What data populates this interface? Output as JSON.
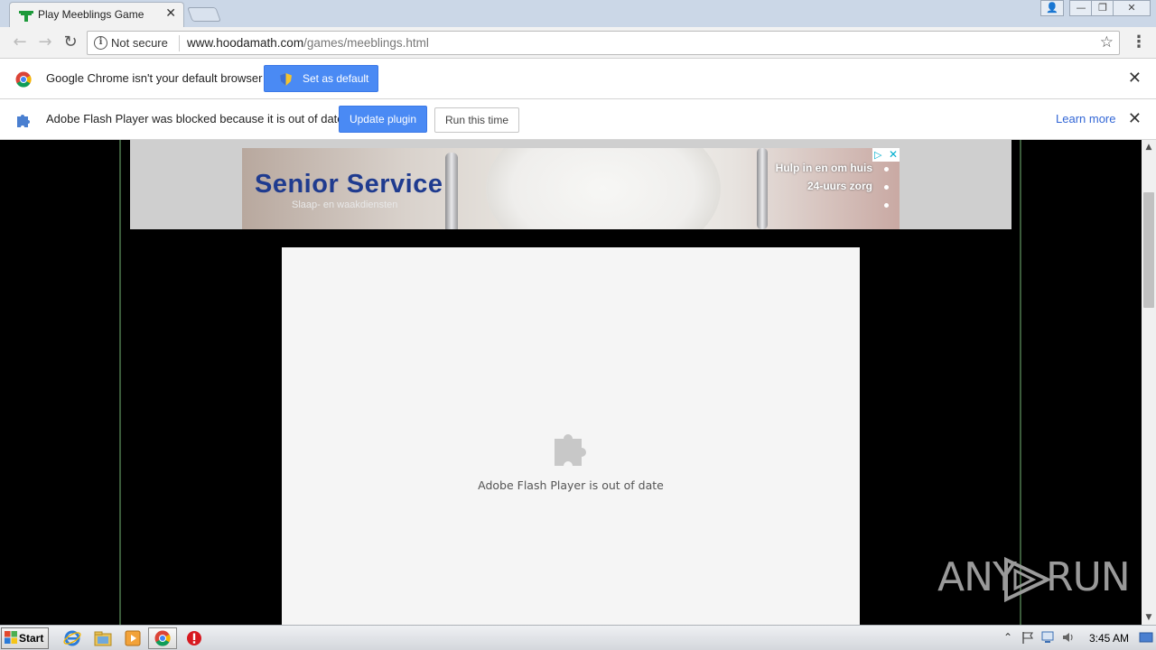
{
  "browser": {
    "tab": {
      "title": "Play Meeblings Game",
      "close": "✕"
    },
    "window_buttons": {
      "user": "👤",
      "minimize": "—",
      "restore": "❐",
      "close": "✕"
    },
    "address": {
      "security_label": "Not secure",
      "url_host": "www.hoodamath.com",
      "url_path": "/games/meeblings.html"
    },
    "nav_glyphs": {
      "back": "←",
      "forward": "→",
      "reload": "↻",
      "star": "☆",
      "menu": "⋮"
    }
  },
  "infobars": {
    "default_browser": {
      "message": "Google Chrome isn't your default browser",
      "button": "Set as default",
      "close": "✕"
    },
    "flash": {
      "message": "Adobe Flash Player was blocked because it is out of date",
      "update_button": "Update plugin",
      "run_button": "Run this time",
      "learn_more": "Learn more",
      "close": "✕"
    }
  },
  "ad": {
    "title": "Senior Service",
    "subtitle": "Slaap- en waakdiensten",
    "bullets": [
      "Hulp in en om huis",
      "24-uurs zorg",
      ""
    ],
    "choices_play": "▷",
    "choices_close": "✕"
  },
  "plugin_placeholder": {
    "message": "Adobe Flash Player is out of date",
    "icon": "puzzle-piece-icon"
  },
  "watermark": {
    "left": "ANY",
    "right": "RUN"
  },
  "scrollbar": {
    "up": "▲",
    "down": "▼"
  },
  "taskbar": {
    "start_label": "Start",
    "clock": "3:45 AM",
    "tray_expand": "⌃"
  },
  "colors": {
    "page_background": "#000000",
    "infobar_button": "#4a8af4",
    "link": "#3367d6",
    "placeholder_bg": "#f5f5f5",
    "ad_title": "#1f3b8f"
  }
}
